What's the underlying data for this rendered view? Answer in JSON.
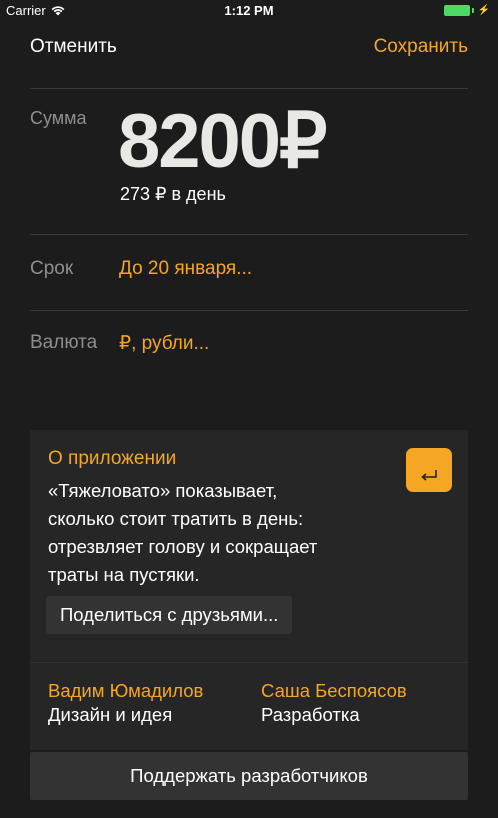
{
  "status_bar": {
    "carrier": "Carrier",
    "time": "1:12 PM"
  },
  "nav": {
    "cancel_label": "Отменить",
    "save_label": "Сохранить"
  },
  "sum": {
    "label": "Сумма",
    "value": "8200₽",
    "per_day": "273 ₽ в день"
  },
  "term": {
    "label": "Срок",
    "value": "До 20 января..."
  },
  "currency": {
    "label": "Валюта",
    "value": "₽, рубли..."
  },
  "about": {
    "title": "О приложении",
    "text_lines": [
      "«Тяжеловато» показывает,",
      "сколько стоит тратить в день:",
      "отрезвляет голову и сокращает",
      "траты на пустяки."
    ],
    "share_label": "Поделиться с друзьями..."
  },
  "credits": [
    {
      "name": "Вадим Юмадилов",
      "role": "Дизайн и идея"
    },
    {
      "name": "Саша Беспоясов",
      "role": "Разработка"
    }
  ],
  "support_label": "Поддержать разработчиков",
  "colors": {
    "accent": "#f5a623",
    "background": "#1c1c1c",
    "battery": "#4cd964"
  }
}
